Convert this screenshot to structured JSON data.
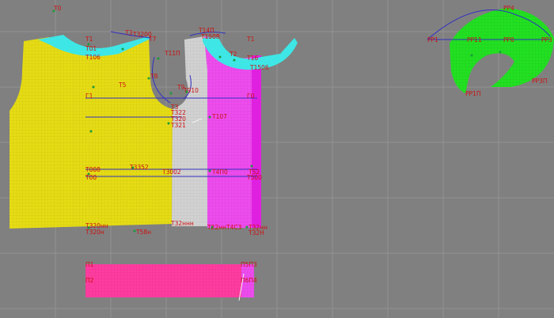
{
  "colors": {
    "background": "#808080",
    "grid": "#8e8e8e",
    "back_piece": "#e6dc14",
    "side_panel": "#d2d2d2",
    "front_piece": "#ee4cee",
    "front_edge": "#e020e0",
    "neck_facing": "#3ee6e6",
    "sleeve": "#22e022",
    "band": "#ff3ca0",
    "curve": "#3030c0",
    "label": "#cc1111",
    "point": "#1a9a3a"
  },
  "labels": {
    "t0": "Т0",
    "t1_left": "Т1",
    "t01": "Т01",
    "t106": "Т106",
    "t3_top": "Т3",
    "t3_suffix": "Т3200",
    "t7": "Т7",
    "t140": "Т14П",
    "t150": "Т1508",
    "t1_right": "Т1",
    "t110": "Т11П",
    "t2": "Т2",
    "t16": "Т16",
    "t1506": "Т1506",
    "t8": "Т8",
    "t5": "Т5",
    "t9": "Т9",
    "t910": "Т910",
    "g1": "Г1",
    "g0": "Г0",
    "t3_mid": "Т3",
    "t322": "Т322",
    "t320": "Т320",
    "t321": "Т321",
    "t107": "Т107",
    "t008": "Т008",
    "t352": "Т3352",
    "t302": "Т3002",
    "t4n0": "Т4П0",
    "t52": "Т52",
    "t00": "Т00",
    "t500": "Т500",
    "t32nn": "Т320нн",
    "t320n": "Т320н",
    "t58n": "Т58н",
    "tcoll": "Т32ннн",
    "t22nn": "Т22нн",
    "t4c3": "Т4С3",
    "t32nn_r": "Т32нн",
    "t32n_r": "Т32Н",
    "p1": "П1",
    "p2": "П2",
    "p5p3": "П5П3",
    "p6p4": "П6П4",
    "pp4": "РР4",
    "pp1": "РР1",
    "pp11": "РР11",
    "pp0": "РР0",
    "pp3": "РР3",
    "pp3p": "РР3П",
    "pp10": "РР1П"
  }
}
